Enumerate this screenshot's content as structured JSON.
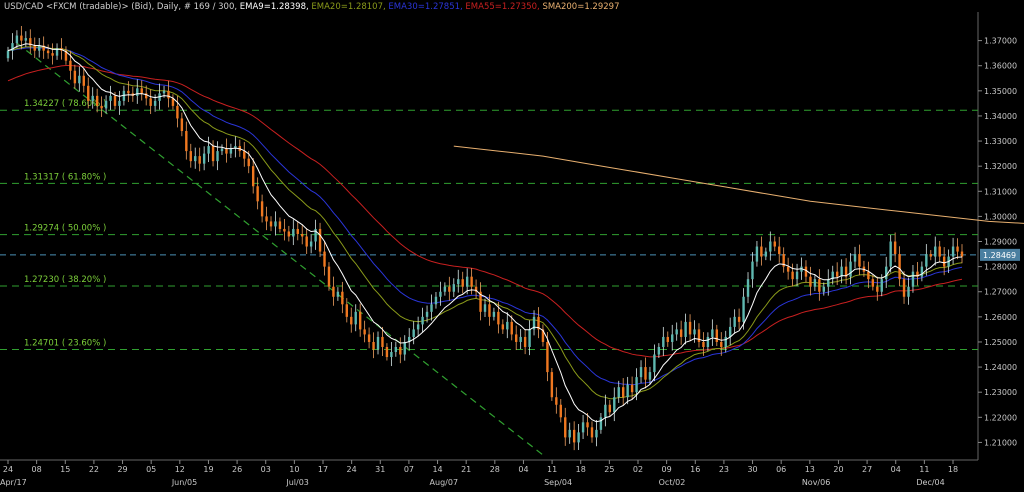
{
  "header": {
    "instrument": "USD/CAD <FXCM (tradable)> (Bid), Daily, # 169 / 300, ",
    "ema9": "EMA9=1.28398, ",
    "ema20": "EMA20=1.28107, ",
    "ema30": "EMA30=1.27851, ",
    "ema55": "EMA55=1.27350, ",
    "sma200": "SMA200=1.29297"
  },
  "colors": {
    "background": "#000000",
    "up": "#5fb8b0",
    "down": "#f07820",
    "ema9": "#ffffff",
    "ema20": "#8a9a1a",
    "ema30": "#2a35d8",
    "ema55": "#c82020",
    "sma200": "#e8b070",
    "fib": "#30a030",
    "trend": "#30a030",
    "current": "#4a8fb5",
    "axis_text": "#c8c8c8",
    "grid": "#3a3a3a"
  },
  "chart_data": {
    "type": "candlestick",
    "ylim": [
      1.203,
      1.379
    ],
    "yticks": [
      "1.21000",
      "1.22000",
      "1.23000",
      "1.24000",
      "1.25000",
      "1.26000",
      "1.27000",
      "1.28000",
      "1.29000",
      "1.30000",
      "1.31000",
      "1.32000",
      "1.33000",
      "1.34000",
      "1.35000",
      "1.36000",
      "1.37000"
    ],
    "xticks": [
      "24",
      "08",
      "15",
      "22",
      "29",
      "05",
      "12",
      "19",
      "26",
      "03",
      "10",
      "17",
      "24",
      "31",
      "07",
      "14",
      "21",
      "28",
      "04",
      "11",
      "18",
      "25",
      "02",
      "09",
      "16",
      "23",
      "30",
      "06",
      "13",
      "20",
      "27",
      "04",
      "11",
      "18"
    ],
    "month_labels": [
      {
        "label": "Apr/17",
        "tick": 0
      },
      {
        "label": "Jun/05",
        "tick": 6
      },
      {
        "label": "Jul/03",
        "tick": 10
      },
      {
        "label": "Aug/07",
        "tick": 15
      },
      {
        "label": "Sep/04",
        "tick": 19
      },
      {
        "label": "Oct/02",
        "tick": 23
      },
      {
        "label": "Nov/06",
        "tick": 28
      },
      {
        "label": "Dec/04",
        "tick": 32
      }
    ],
    "current_price": {
      "value": 1.28469,
      "label": "1.28469"
    },
    "fib_levels": [
      {
        "value": 1.34227,
        "label": "1.34227 ( 78.60% )"
      },
      {
        "value": 1.31317,
        "label": "1.31317 ( 61.80% )"
      },
      {
        "value": 1.29274,
        "label": "1.29274 ( 50.00% )"
      },
      {
        "value": 1.2723,
        "label": "1.27230 ( 38.20% )"
      },
      {
        "value": 1.24701,
        "label": "1.24701 ( 23.60% )"
      }
    ],
    "trendline": {
      "from": [
        2,
        1.369
      ],
      "to": [
        120,
        1.205
      ]
    },
    "closes": [
      1.366,
      1.369,
      1.372,
      1.37,
      1.371,
      1.368,
      1.366,
      1.368,
      1.366,
      1.365,
      1.364,
      1.367,
      1.366,
      1.362,
      1.358,
      1.353,
      1.356,
      1.352,
      1.346,
      1.348,
      1.344,
      1.343,
      1.346,
      1.348,
      1.344,
      1.346,
      1.35,
      1.349,
      1.348,
      1.351,
      1.349,
      1.347,
      1.344,
      1.346,
      1.349,
      1.35,
      1.347,
      1.344,
      1.339,
      1.334,
      1.326,
      1.322,
      1.324,
      1.321,
      1.325,
      1.328,
      1.322,
      1.326,
      1.327,
      1.325,
      1.327,
      1.328,
      1.326,
      1.323,
      1.32,
      1.312,
      1.306,
      1.3,
      1.298,
      1.296,
      1.298,
      1.295,
      1.294,
      1.292,
      1.295,
      1.293,
      1.292,
      1.288,
      1.29,
      1.295,
      1.286,
      1.28,
      1.272,
      1.268,
      1.27,
      1.265,
      1.26,
      1.257,
      1.262,
      1.255,
      1.253,
      1.25,
      1.247,
      1.252,
      1.248,
      1.244,
      1.246,
      1.248,
      1.245,
      1.25,
      1.252,
      1.255,
      1.257,
      1.26,
      1.262,
      1.265,
      1.268,
      1.27,
      1.272,
      1.27,
      1.273,
      1.275,
      1.272,
      1.276,
      1.272,
      1.27,
      1.262,
      1.265,
      1.26,
      1.262,
      1.257,
      1.255,
      1.258,
      1.253,
      1.25,
      1.252,
      1.248,
      1.255,
      1.26,
      1.255,
      1.25,
      1.238,
      1.228,
      1.225,
      1.22,
      1.212,
      1.215,
      1.21,
      1.214,
      1.218,
      1.216,
      1.212,
      1.215,
      1.22,
      1.225,
      1.222,
      1.228,
      1.232,
      1.228,
      1.233,
      1.23,
      1.236,
      1.24,
      1.235,
      1.238,
      1.245,
      1.248,
      1.252,
      1.25,
      1.253,
      1.255,
      1.252,
      1.258,
      1.253,
      1.255,
      1.25,
      1.248,
      1.252,
      1.255,
      1.25,
      1.248,
      1.252,
      1.256,
      1.26,
      1.258,
      1.268,
      1.275,
      1.282,
      1.288,
      1.284,
      1.286,
      1.29,
      1.288,
      1.285,
      1.28,
      1.278,
      1.275,
      1.278,
      1.28,
      1.276,
      1.272,
      1.275,
      1.27,
      1.272,
      1.275,
      1.278,
      1.276,
      1.28,
      1.276,
      1.282,
      1.285,
      1.28,
      1.278,
      1.275,
      1.272,
      1.27,
      1.275,
      1.28,
      1.29,
      1.285,
      1.275,
      1.268,
      1.272,
      1.278,
      1.276,
      1.28,
      1.285,
      1.284,
      1.288,
      1.284,
      1.28,
      1.284,
      1.288,
      1.286,
      1.284
    ],
    "sma200": [
      [
        100,
        1.328
      ],
      [
        110,
        1.326
      ],
      [
        120,
        1.324
      ],
      [
        130,
        1.321
      ],
      [
        140,
        1.318
      ],
      [
        150,
        1.315
      ],
      [
        160,
        1.312
      ],
      [
        170,
        1.309
      ],
      [
        180,
        1.306
      ],
      [
        190,
        1.304
      ],
      [
        200,
        1.302
      ],
      [
        210,
        1.3
      ],
      [
        220,
        1.298
      ],
      [
        230,
        1.297
      ],
      [
        240,
        1.295
      ],
      [
        250,
        1.293
      ]
    ]
  }
}
